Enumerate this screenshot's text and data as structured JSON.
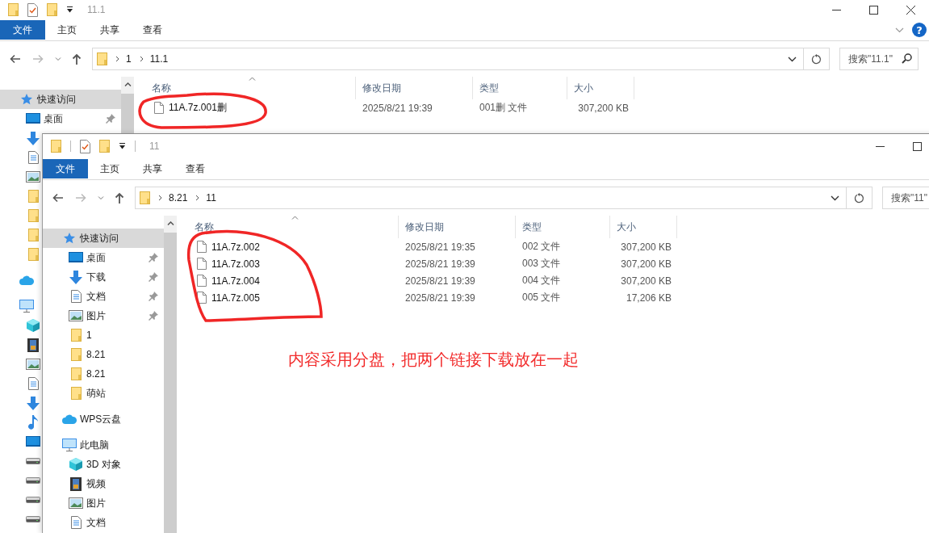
{
  "windows": [
    {
      "title": "11.1",
      "help": "?",
      "tabs": [
        {
          "label": "文件",
          "kind": "file"
        },
        {
          "label": "主页",
          "kind": "tab"
        },
        {
          "label": "共享",
          "kind": "tab"
        },
        {
          "label": "查看",
          "kind": "tab"
        }
      ],
      "path": [
        "1",
        "11.1"
      ],
      "search": {
        "placeholder": "搜索\"11.1\""
      },
      "nav": [
        {
          "kind": "star",
          "label": "快速访问",
          "selected": true,
          "children": [
            {
              "kind": "desktop",
              "label": "桌面",
              "pinned": true,
              "selected": false
            },
            {
              "kind": "download",
              "selected": false
            },
            {
              "kind": "document",
              "selected": false
            },
            {
              "kind": "pictures",
              "selected": false
            },
            {
              "kind": "folder",
              "selected": false
            },
            {
              "kind": "folder",
              "selected": false
            },
            {
              "kind": "folder",
              "selected": false
            },
            {
              "kind": "folder",
              "selected": false
            }
          ]
        },
        {
          "kind": "cloud",
          "selected": false
        },
        {
          "kind": "pc",
          "selected": false,
          "children": [
            {
              "kind": "cube",
              "selected": false
            },
            {
              "kind": "video",
              "selected": false
            },
            {
              "kind": "pictures",
              "selected": false
            },
            {
              "kind": "document",
              "selected": false
            },
            {
              "kind": "download",
              "selected": false
            },
            {
              "kind": "music",
              "selected": false
            },
            {
              "kind": "desktop",
              "selected": false
            },
            {
              "kind": "drive",
              "selected": false
            },
            {
              "kind": "drive",
              "selected": false
            },
            {
              "kind": "drive",
              "selected": false
            },
            {
              "kind": "drive",
              "selected": false
            }
          ]
        }
      ],
      "columns": [
        "名称",
        "修改日期",
        "类型",
        "大小"
      ],
      "rows": [
        {
          "name": "11A.7z.001删",
          "date": "2025/8/21 19:39",
          "type": "001删 文件",
          "size": "307,200 KB"
        }
      ]
    },
    {
      "title": "11",
      "tabs": [
        {
          "label": "文件",
          "kind": "file"
        },
        {
          "label": "主页",
          "kind": "tab"
        },
        {
          "label": "共享",
          "kind": "tab"
        },
        {
          "label": "查看",
          "kind": "tab"
        }
      ],
      "path": [
        "8.21",
        "11"
      ],
      "search": {
        "placeholder": "搜索\"11\""
      },
      "nav": [
        {
          "kind": "star",
          "label": "快速访问",
          "selected": true,
          "children": [
            {
              "kind": "desktop",
              "label": "桌面",
              "pinned": true,
              "selected": false
            },
            {
              "kind": "download",
              "label": "下载",
              "pinned": true,
              "selected": false
            },
            {
              "kind": "document",
              "label": "文档",
              "pinned": true,
              "selected": false
            },
            {
              "kind": "pictures",
              "label": "图片",
              "pinned": true,
              "selected": false
            },
            {
              "kind": "folder",
              "label": "1",
              "pinned": false,
              "selected": false
            },
            {
              "kind": "folder",
              "label": "8.21",
              "pinned": false,
              "selected": false
            },
            {
              "kind": "folder",
              "label": "8.21",
              "pinned": false,
              "selected": false
            },
            {
              "kind": "folder",
              "label": "萌站",
              "pinned": false,
              "selected": false
            }
          ]
        },
        {
          "kind": "cloud",
          "label": "WPS云盘",
          "selected": false
        },
        {
          "kind": "pc",
          "label": "此电脑",
          "selected": false,
          "children": [
            {
              "kind": "cube",
              "label": "3D 对象",
              "pinned": false,
              "selected": false
            },
            {
              "kind": "video",
              "label": "视频",
              "pinned": false,
              "selected": false
            },
            {
              "kind": "pictures",
              "label": "图片",
              "pinned": false,
              "selected": false
            },
            {
              "kind": "document",
              "label": "文档",
              "pinned": false,
              "selected": false
            }
          ]
        }
      ],
      "columns": [
        "名称",
        "修改日期",
        "类型",
        "大小"
      ],
      "rows": [
        {
          "name": "11A.7z.002",
          "date": "2025/8/21 19:35",
          "type": "002 文件",
          "size": "307,200 KB"
        },
        {
          "name": "11A.7z.003",
          "date": "2025/8/21 19:39",
          "type": "003 文件",
          "size": "307,200 KB"
        },
        {
          "name": "11A.7z.004",
          "date": "2025/8/21 19:39",
          "type": "004 文件",
          "size": "307,200 KB"
        },
        {
          "name": "11A.7z.005",
          "date": "2025/8/21 19:39",
          "type": "005 文件",
          "size": "17,206 KB"
        }
      ]
    }
  ],
  "annotations": [
    {
      "kind": "circle"
    },
    {
      "kind": "circle"
    },
    {
      "kind": "note",
      "text": "内容采用分盘，把两个链接下载放在一起"
    }
  ]
}
